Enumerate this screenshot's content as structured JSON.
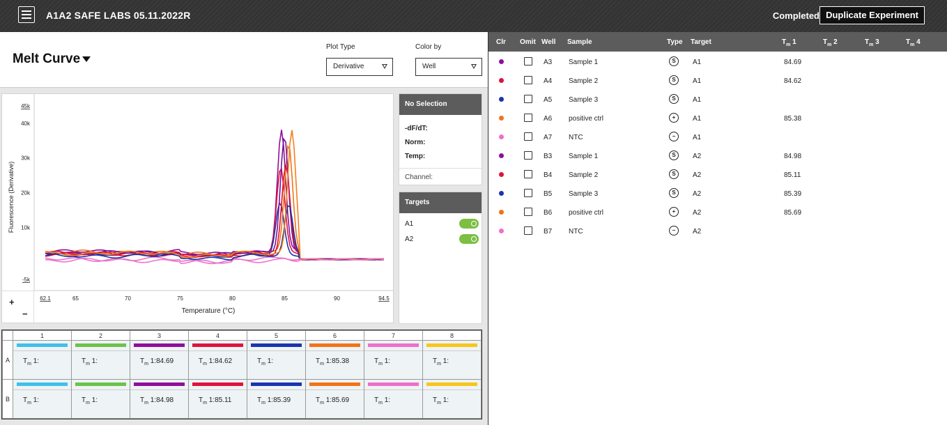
{
  "app": {
    "title": "A1A2 SAFE LABS 05.11.2022R",
    "status": "Completed",
    "duplicate_label": "Duplicate Experiment"
  },
  "view": {
    "title": "Melt Curve",
    "plot_type_label": "Plot Type",
    "plot_type_value": "Derivative",
    "color_by_label": "Color by",
    "color_by_value": "Well"
  },
  "selection": {
    "header": "No Selection",
    "rows": [
      "-dF/dT:",
      "Norm:",
      "Temp:"
    ],
    "channel_label": "Channel:"
  },
  "targets": {
    "header": "Targets",
    "items": [
      {
        "label": "A1",
        "on": true
      },
      {
        "label": "A2",
        "on": true
      }
    ]
  },
  "chart_data": {
    "type": "line",
    "xlabel": "Temperature (°C)",
    "ylabel": "Fluorescence (Derivative)",
    "xlim": [
      62.1,
      94.5
    ],
    "ylim": [
      -5000,
      45000
    ],
    "x_ticks": [
      62.1,
      65,
      70,
      75,
      80,
      85,
      90,
      94.5
    ],
    "x_tick_labels": [
      "62.1",
      "65",
      "70",
      "75",
      "80",
      "85",
      "90",
      "94.5"
    ],
    "y_ticks": [
      -5000,
      10000,
      20000,
      30000,
      40000,
      45000
    ],
    "y_tick_labels": [
      "-5k",
      "10k",
      "20k",
      "30k",
      "40k",
      "45k"
    ],
    "grid": false,
    "series": [
      {
        "well": "A3",
        "color": "#8e0f9b",
        "peak_x": 84.69,
        "peak_y": 38200,
        "baseline": 3000
      },
      {
        "well": "A4",
        "color": "#e0123b",
        "peak_x": 84.62,
        "peak_y": 27000,
        "baseline": 2500
      },
      {
        "well": "A5",
        "color": "#1a35b0",
        "peak_x": 84.55,
        "peak_y": 17000,
        "baseline": 2200
      },
      {
        "well": "A6",
        "color": "#f07418",
        "peak_x": 85.38,
        "peak_y": 34000,
        "baseline": 2800
      },
      {
        "well": "A7",
        "color": "#ee6fc8",
        "peak_x": 85.0,
        "peak_y": 1200,
        "baseline": 800
      },
      {
        "well": "B3",
        "color": "#7a1098",
        "peak_x": 84.98,
        "peak_y": 36800,
        "baseline": 2700
      },
      {
        "well": "B4",
        "color": "#d9102f",
        "peak_x": 85.11,
        "peak_y": 28000,
        "baseline": 2300
      },
      {
        "well": "B5",
        "color": "#1a2fa0",
        "peak_x": 85.39,
        "peak_y": 16000,
        "baseline": 1800
      },
      {
        "well": "B6",
        "color": "#f27f20",
        "peak_x": 85.69,
        "peak_y": 38200,
        "baseline": 2500
      },
      {
        "well": "B7",
        "color": "#ea74cf",
        "peak_x": 85.0,
        "peak_y": 900,
        "baseline": 500
      }
    ]
  },
  "plate": {
    "columns": [
      "1",
      "2",
      "3",
      "4",
      "5",
      "6",
      "7",
      "8"
    ],
    "rows": [
      {
        "label": "A",
        "cells": [
          {
            "color": "#3fc0ea",
            "tm": ""
          },
          {
            "color": "#6cc24a",
            "tm": ""
          },
          {
            "color": "#8e0f9b",
            "tm": "84.69"
          },
          {
            "color": "#e0123b",
            "tm": "84.62"
          },
          {
            "color": "#1a35b0",
            "tm": ""
          },
          {
            "color": "#f07418",
            "tm": "85.38"
          },
          {
            "color": "#ee6fc8",
            "tm": ""
          },
          {
            "color": "#f7c61a",
            "tm": ""
          }
        ]
      },
      {
        "label": "B",
        "cells": [
          {
            "color": "#3fc0ea",
            "tm": ""
          },
          {
            "color": "#6cc24a",
            "tm": ""
          },
          {
            "color": "#8e0f9b",
            "tm": "84.98"
          },
          {
            "color": "#e0123b",
            "tm": "85.11"
          },
          {
            "color": "#1a35b0",
            "tm": "85.39"
          },
          {
            "color": "#f07418",
            "tm": "85.69"
          },
          {
            "color": "#ee6fc8",
            "tm": ""
          },
          {
            "color": "#f7c61a",
            "tm": ""
          }
        ]
      }
    ],
    "tm_prefix": "T",
    "tm_sub": "m",
    "tm_suffix": " 1:"
  },
  "well_table": {
    "headers": {
      "clr": "Clr",
      "omit": "Omit",
      "well": "Well",
      "sample": "Sample",
      "type": "Type",
      "target": "Target",
      "tm1": "T|m|1",
      "tm2": "T|m|2",
      "tm3": "T|m|3",
      "tm4": "T|m|4"
    },
    "rows": [
      {
        "color": "#8e0f9b",
        "well": "A3",
        "sample": "Sample 1",
        "type": "S",
        "target": "A1",
        "tm1": "84.69"
      },
      {
        "color": "#e0123b",
        "well": "A4",
        "sample": "Sample 2",
        "type": "S",
        "target": "A1",
        "tm1": "84.62"
      },
      {
        "color": "#1a35b0",
        "well": "A5",
        "sample": "Sample 3",
        "type": "S",
        "target": "A1",
        "tm1": ""
      },
      {
        "color": "#f07418",
        "well": "A6",
        "sample": "positive ctrl",
        "type": "+",
        "target": "A1",
        "tm1": "85.38"
      },
      {
        "color": "#ee6fc8",
        "well": "A7",
        "sample": "NTC",
        "type": "−",
        "target": "A1",
        "tm1": ""
      },
      {
        "color": "#8e0f9b",
        "well": "B3",
        "sample": "Sample 1",
        "type": "S",
        "target": "A2",
        "tm1": "84.98"
      },
      {
        "color": "#e0123b",
        "well": "B4",
        "sample": "Sample 2",
        "type": "S",
        "target": "A2",
        "tm1": "85.11"
      },
      {
        "color": "#1a35b0",
        "well": "B5",
        "sample": "Sample 3",
        "type": "S",
        "target": "A2",
        "tm1": "85.39"
      },
      {
        "color": "#f07418",
        "well": "B6",
        "sample": "positive ctrl",
        "type": "+",
        "target": "A2",
        "tm1": "85.69"
      },
      {
        "color": "#ee6fc8",
        "well": "B7",
        "sample": "NTC",
        "type": "−",
        "target": "A2",
        "tm1": ""
      }
    ]
  }
}
